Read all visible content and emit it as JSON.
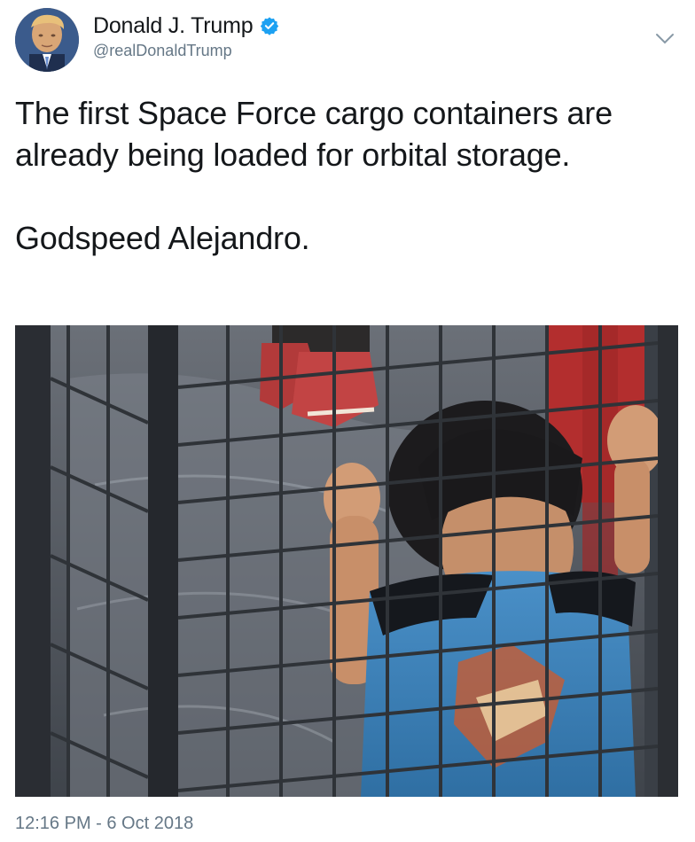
{
  "author": {
    "display_name": "Donald J. Trump",
    "handle": "@realDonaldTrump",
    "verified": true,
    "verified_icon": "verified-badge-icon",
    "avatar_icon": "profile-photo"
  },
  "menu": {
    "icon": "chevron-down-icon"
  },
  "tweet": {
    "line_1": "The first Space Force cargo containers are already being loaded for orbital storage.",
    "line_2": "Godspeed Alejandro."
  },
  "media": {
    "kind": "photo",
    "subject": "child-behind-wire-fence-photo"
  },
  "meta": {
    "timestamp": "12:16 PM - 6 Oct 2018"
  },
  "colors": {
    "text": "#14171a",
    "secondary": "#657786",
    "verified_blue": "#1da1f2",
    "background": "#ffffff"
  }
}
